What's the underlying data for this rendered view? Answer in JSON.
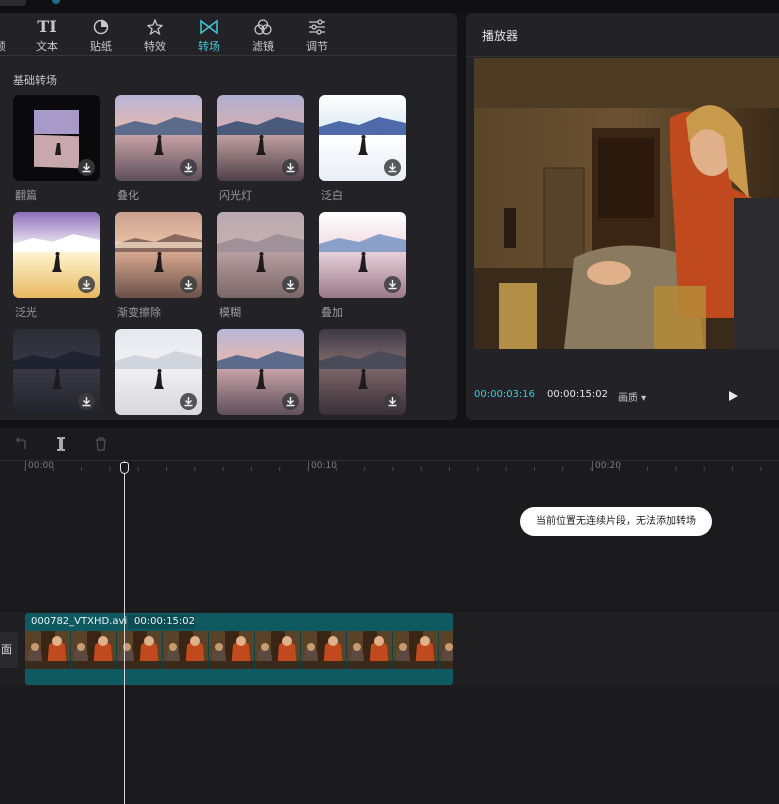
{
  "tabs": [
    {
      "label": "频",
      "icon": "media-icon"
    },
    {
      "label": "文本",
      "icon": "text-icon"
    },
    {
      "label": "贴纸",
      "icon": "sticker-icon"
    },
    {
      "label": "特效",
      "icon": "effects-icon"
    },
    {
      "label": "转场",
      "icon": "transition-icon",
      "active": true
    },
    {
      "label": "滤镜",
      "icon": "filter-icon"
    },
    {
      "label": "调节",
      "icon": "adjust-icon"
    }
  ],
  "section_title": "基础转场",
  "transitions": [
    {
      "label": "翻篇"
    },
    {
      "label": "叠化"
    },
    {
      "label": "闪光灯"
    },
    {
      "label": "泛白"
    },
    {
      "label": "泛光"
    },
    {
      "label": "渐变擦除"
    },
    {
      "label": "模糊"
    },
    {
      "label": "叠加"
    },
    {
      "label": ""
    },
    {
      "label": ""
    },
    {
      "label": ""
    },
    {
      "label": ""
    }
  ],
  "player": {
    "title": "播放器",
    "current_time": "00:00:03:16",
    "total_time": "00:00:15:02",
    "quality": "画质 ▾"
  },
  "timeline": {
    "ticks": [
      "00:00",
      "00:10",
      "00:20"
    ],
    "toast": "当前位置无连续片段，无法添加转场",
    "track_label": "面",
    "clip": {
      "name": "000782_VTXHD.avi",
      "duration": "00:00:15:02"
    }
  },
  "colors": {
    "accent": "#3fc7d8",
    "clip": "#0f5a61",
    "panel": "#232327"
  }
}
